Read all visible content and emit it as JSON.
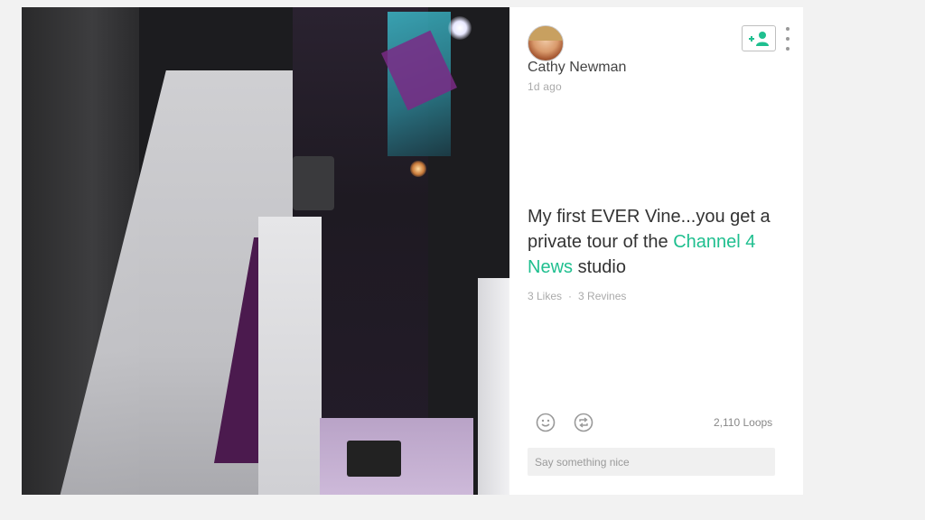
{
  "post": {
    "user_name": "Cathy Newman",
    "timestamp": "1d ago",
    "description_before": "My first EVER Vine...you get a private tour of the ",
    "description_link": "Channel 4 News",
    "description_after": " studio",
    "likes_label": "3 Likes",
    "separator": "·",
    "revines_label": "3 Revines",
    "loops_label": "2,110 Loops",
    "comment_placeholder": "Say something nice"
  },
  "icons": {
    "follow": "add-user-icon",
    "more": "more-vertical-icon",
    "like": "smiley-icon",
    "revine": "revine-icon"
  },
  "colors": {
    "accent": "#1fbf8f",
    "background": "#f2f2f2",
    "card": "#ffffff",
    "muted_text": "#aaaaaa"
  }
}
